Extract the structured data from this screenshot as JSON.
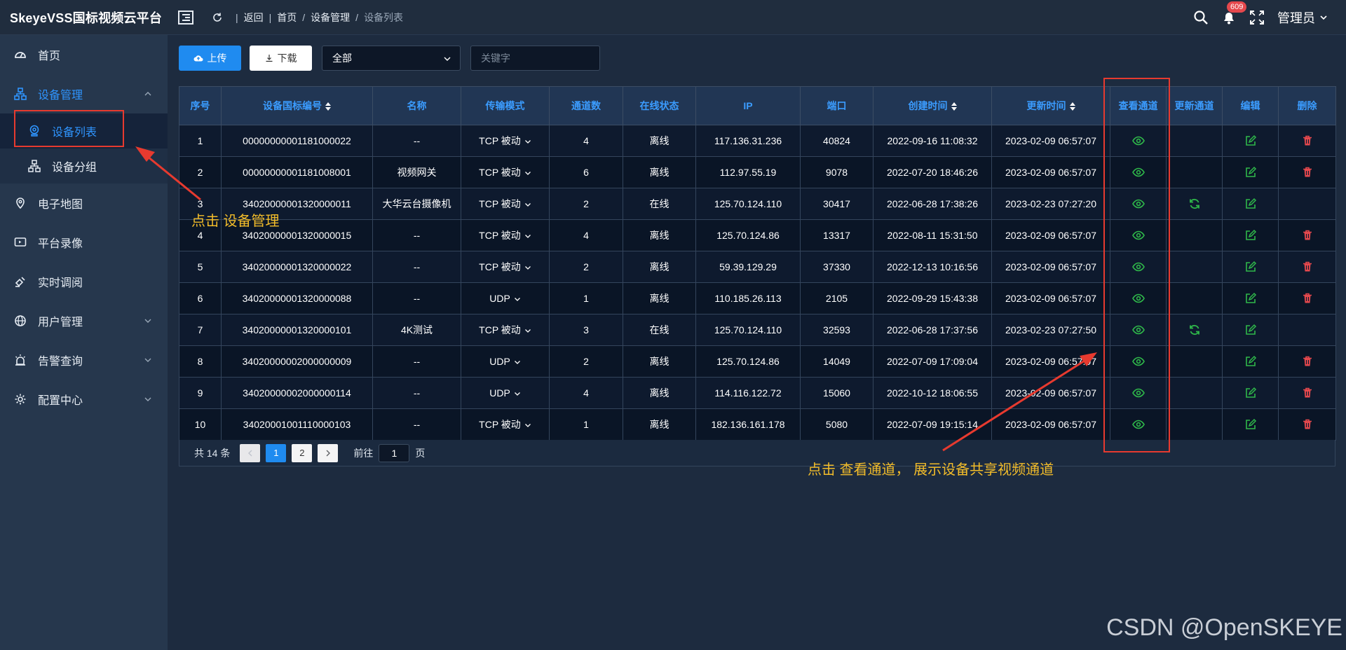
{
  "app": {
    "title": "SkeyeVSS国标视频云平台"
  },
  "breadcrumb": {
    "back": "返回",
    "home": "首页",
    "parent": "设备管理",
    "current": "设备列表"
  },
  "header": {
    "notification_count": "609",
    "user": "管理员"
  },
  "sidebar": {
    "items": [
      {
        "label": "首页"
      },
      {
        "label": "设备管理"
      },
      {
        "label": "电子地图"
      },
      {
        "label": "平台录像"
      },
      {
        "label": "实时调阅"
      },
      {
        "label": "用户管理"
      },
      {
        "label": "告警查询"
      },
      {
        "label": "配置中心"
      }
    ],
    "submenu": [
      {
        "label": "设备列表"
      },
      {
        "label": "设备分组"
      }
    ]
  },
  "toolbar": {
    "upload_label": "上传",
    "download_label": "下载",
    "filter_value": "全部",
    "keyword_placeholder": "关键字"
  },
  "table": {
    "headers": [
      "序号",
      "设备国标编号",
      "名称",
      "传输模式",
      "通道数",
      "在线状态",
      "IP",
      "端口",
      "创建时间",
      "更新时间",
      "查看通道",
      "更新通道",
      "编辑",
      "删除"
    ],
    "rows": [
      {
        "no": "1",
        "id": "00000000001181000022",
        "name": "--",
        "mode": "TCP 被动",
        "channels": "4",
        "status": "离线",
        "ip": "117.136.31.236",
        "port": "40824",
        "created": "2022-09-16 11:08:32",
        "updated": "2023-02-09 06:57:07",
        "refresh": false,
        "del": true
      },
      {
        "no": "2",
        "id": "00000000001181008001",
        "name": "视频网关",
        "mode": "TCP 被动",
        "channels": "6",
        "status": "离线",
        "ip": "112.97.55.19",
        "port": "9078",
        "created": "2022-07-20 18:46:26",
        "updated": "2023-02-09 06:57:07",
        "refresh": false,
        "del": true
      },
      {
        "no": "3",
        "id": "34020000001320000011",
        "name": "大华云台摄像机",
        "mode": "TCP 被动",
        "channels": "2",
        "status": "在线",
        "ip": "125.70.124.110",
        "port": "30417",
        "created": "2022-06-28 17:38:26",
        "updated": "2023-02-23 07:27:20",
        "refresh": true,
        "del": false
      },
      {
        "no": "4",
        "id": "34020000001320000015",
        "name": "--",
        "mode": "TCP 被动",
        "channels": "4",
        "status": "离线",
        "ip": "125.70.124.86",
        "port": "13317",
        "created": "2022-08-11 15:31:50",
        "updated": "2023-02-09 06:57:07",
        "refresh": false,
        "del": true
      },
      {
        "no": "5",
        "id": "34020000001320000022",
        "name": "--",
        "mode": "TCP 被动",
        "channels": "2",
        "status": "离线",
        "ip": "59.39.129.29",
        "port": "37330",
        "created": "2022-12-13 10:16:56",
        "updated": "2023-02-09 06:57:07",
        "refresh": false,
        "del": true
      },
      {
        "no": "6",
        "id": "34020000001320000088",
        "name": "--",
        "mode": "UDP",
        "channels": "1",
        "status": "离线",
        "ip": "110.185.26.113",
        "port": "2105",
        "created": "2022-09-29 15:43:38",
        "updated": "2023-02-09 06:57:07",
        "refresh": false,
        "del": true
      },
      {
        "no": "7",
        "id": "34020000001320000101",
        "name": "4K测试",
        "mode": "TCP 被动",
        "channels": "3",
        "status": "在线",
        "ip": "125.70.124.110",
        "port": "32593",
        "created": "2022-06-28 17:37:56",
        "updated": "2023-02-23 07:27:50",
        "refresh": true,
        "del": false
      },
      {
        "no": "8",
        "id": "34020000002000000009",
        "name": "--",
        "mode": "UDP",
        "channels": "2",
        "status": "离线",
        "ip": "125.70.124.86",
        "port": "14049",
        "created": "2022-07-09 17:09:04",
        "updated": "2023-02-09 06:57:07",
        "refresh": false,
        "del": true
      },
      {
        "no": "9",
        "id": "34020000002000000114",
        "name": "--",
        "mode": "UDP",
        "channels": "4",
        "status": "离线",
        "ip": "114.116.122.72",
        "port": "15060",
        "created": "2022-10-12 18:06:55",
        "updated": "2023-02-09 06:57:07",
        "refresh": false,
        "del": true
      },
      {
        "no": "10",
        "id": "34020001001110000103",
        "name": "--",
        "mode": "TCP 被动",
        "channels": "1",
        "status": "离线",
        "ip": "182.136.161.178",
        "port": "5080",
        "created": "2022-07-09 19:15:14",
        "updated": "2023-02-09 06:57:07",
        "refresh": false,
        "del": true
      }
    ]
  },
  "pagination": {
    "total_text": "共 14 条",
    "pages": [
      "1",
      "2"
    ],
    "current_page": "1",
    "goto_label": "前往",
    "goto_value": "1",
    "page_suffix": "页"
  },
  "annotations": {
    "left_note": "点击 设备管理",
    "right_note": "点击 查看通道， 展示设备共享视频通道"
  },
  "watermark": "CSDN @OpenSKEYE",
  "colors": {
    "accent": "#1f8bf0",
    "view": "#2fb84a",
    "delete": "#e5484d",
    "annotation": "#e73a2f",
    "note": "#f2bc2a"
  }
}
